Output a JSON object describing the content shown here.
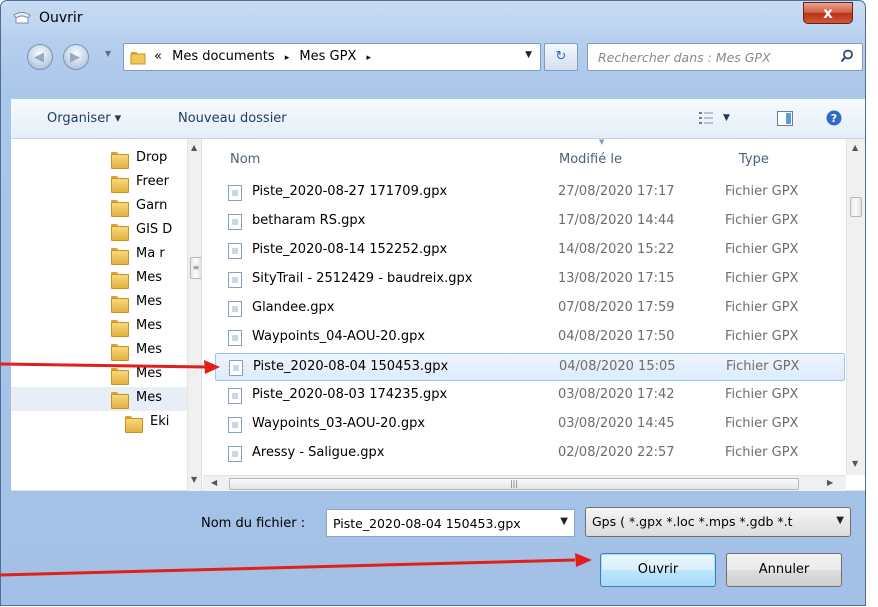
{
  "window": {
    "title": "Ouvrir",
    "close_label": "x"
  },
  "nav": {
    "breadcrumbs": [
      "«",
      "Mes documents",
      "▸",
      "Mes GPX",
      "▸"
    ],
    "search_placeholder": "Rechercher dans : Mes GPX"
  },
  "toolbar": {
    "organize_label": "Organiser ▾",
    "new_folder_label": "Nouveau dossier"
  },
  "tree": {
    "items": [
      {
        "label": "Drop"
      },
      {
        "label": "Freer"
      },
      {
        "label": "Garn"
      },
      {
        "label": "GIS D"
      },
      {
        "label": "Ma r"
      },
      {
        "label": "Mes"
      },
      {
        "label": "Mes"
      },
      {
        "label": "Mes"
      },
      {
        "label": "Mes"
      },
      {
        "label": "Mes"
      },
      {
        "label": "Mes"
      },
      {
        "label": "Eki"
      }
    ]
  },
  "files": {
    "columns": {
      "name": "Nom",
      "modified": "Modifié le",
      "type": "Type"
    },
    "rows": [
      {
        "name": "Piste_2020-08-27 171709.gpx",
        "modified": "27/08/2020 17:17",
        "type": "Fichier GPX"
      },
      {
        "name": "betharam RS.gpx",
        "modified": "17/08/2020 14:44",
        "type": "Fichier GPX"
      },
      {
        "name": "Piste_2020-08-14 152252.gpx",
        "modified": "14/08/2020 15:22",
        "type": "Fichier GPX"
      },
      {
        "name": "SityTrail - 2512429 - baudreix.gpx",
        "modified": "13/08/2020 17:15",
        "type": "Fichier GPX"
      },
      {
        "name": "Glandee.gpx",
        "modified": "07/08/2020 17:59",
        "type": "Fichier GPX"
      },
      {
        "name": "Waypoints_04-AOU-20.gpx",
        "modified": "04/08/2020 17:50",
        "type": "Fichier GPX"
      },
      {
        "name": "Piste_2020-08-04 150453.gpx",
        "modified": "04/08/2020 15:05",
        "type": "Fichier GPX"
      },
      {
        "name": "Piste_2020-08-03 174235.gpx",
        "modified": "03/08/2020 17:42",
        "type": "Fichier GPX"
      },
      {
        "name": "Waypoints_03-AOU-20.gpx",
        "modified": "03/08/2020 14:45",
        "type": "Fichier GPX"
      },
      {
        "name": "Aressy - Saligue.gpx",
        "modified": "02/08/2020 22:57",
        "type": "Fichier GPX"
      }
    ],
    "selected_index": 6
  },
  "footer": {
    "filename_label": "Nom du fichier :",
    "filename_value": "Piste_2020-08-04 150453.gpx",
    "filetype_value": "Gps ( *.gpx *.loc *.mps *.gdb *.t",
    "open_label": "Ouvrir",
    "cancel_label": "Annuler"
  },
  "colors": {
    "annotation_arrow": "#e0201b",
    "selection": "#dcebfc",
    "title_gradient": "#b7cfee"
  }
}
